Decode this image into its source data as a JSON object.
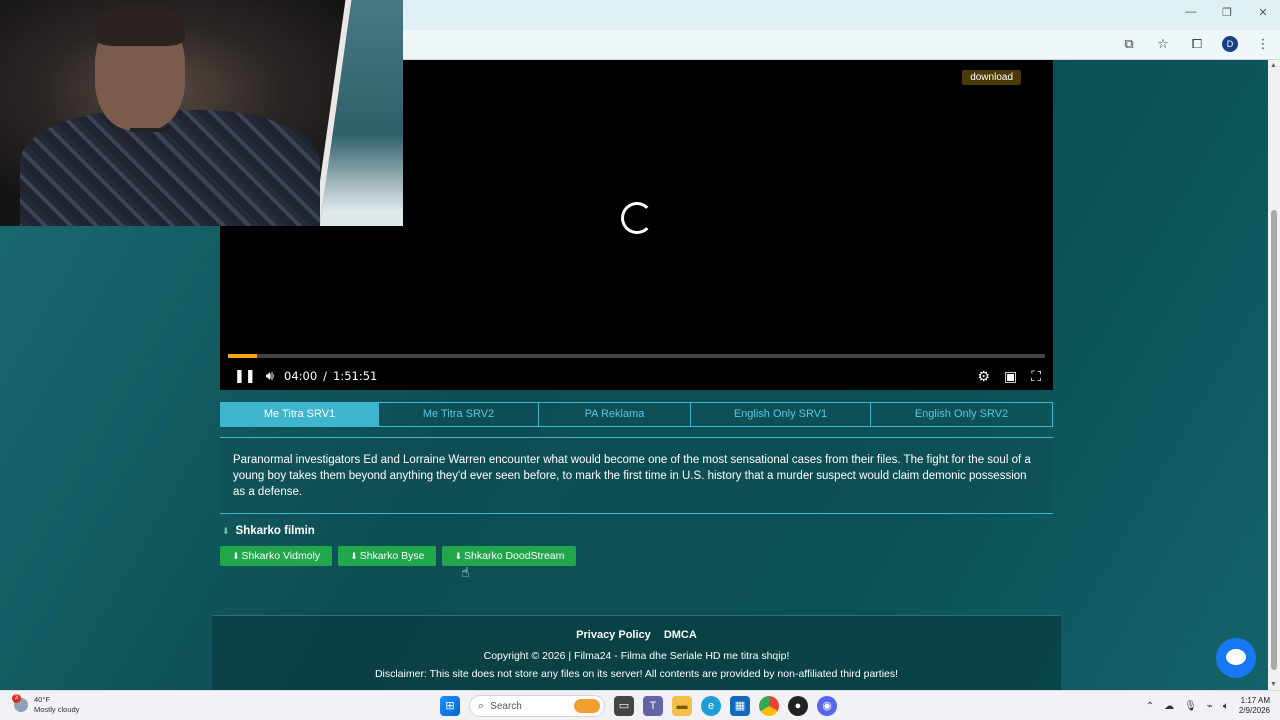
{
  "browser": {
    "window_controls": [
      "—",
      "❐",
      "✕"
    ],
    "toolbar_icons": [
      "cast-icon",
      "star-icon",
      "extensions-icon",
      "profile-avatar",
      "menu-icon"
    ],
    "profile_initial": "D"
  },
  "player": {
    "download_label": "download",
    "current_time": "04:00",
    "separator": "/",
    "duration": "1:51:51",
    "progress_fraction": 0.036
  },
  "servers": [
    {
      "label": "Me Titra SRV1",
      "active": true
    },
    {
      "label": "Me Titra SRV2",
      "active": false
    },
    {
      "label": "PA Reklama",
      "active": false
    },
    {
      "label": "English Only SRV1",
      "active": false
    },
    {
      "label": "English Only SRV2",
      "active": false
    }
  ],
  "description": "Paranormal investigators Ed and Lorraine Warren encounter what would become one of the most sensational cases from their files. The fight for the soul of a young boy takes them beyond anything they'd ever seen before, to mark the first time in U.S. history that a murder suspect would claim demonic possession as a defense.",
  "downloads": {
    "title": "Shkarko filmin",
    "links": [
      "Shkarko Vidmoly",
      "Shkarko Byse",
      "Shkarko DoodStream"
    ]
  },
  "footer": {
    "links": [
      "Privacy Policy",
      "DMCA"
    ],
    "copyright": "Copyright © 2026 | Filma24 - Filma dhe Seriale HD me titra shqip!",
    "disclaimer": "Disclaimer: This site does not store any files on its server! All contents are provided by non-affiliated third parties!"
  },
  "taskbar": {
    "weather_badge": "3",
    "temperature": "40°F",
    "condition": "Mostly cloudy",
    "search_placeholder": "Search",
    "time": "1:17 AM",
    "date": "2/9/2026"
  },
  "colors": {
    "accent": "#3fb6cf",
    "download_green": "#20a64b",
    "progress": "#f5a60c"
  }
}
